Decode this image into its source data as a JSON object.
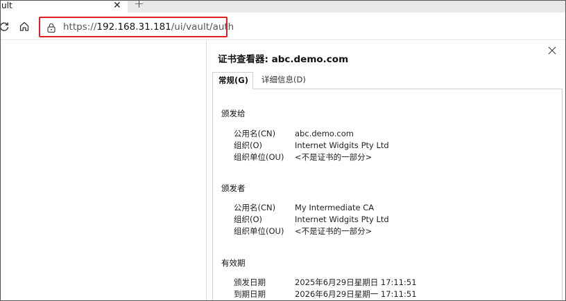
{
  "browser": {
    "tab_title": "ult",
    "tab_close": "✕",
    "new_tab": "+",
    "address": {
      "scheme": "https://",
      "host": "192.168.31.181",
      "path": "/ui/vault/auth"
    }
  },
  "cert_viewer": {
    "title": "证书查看器: abc.demo.com",
    "tabs": [
      {
        "label": "常规(G)",
        "active": true
      },
      {
        "label": "详细信息(D)",
        "active": false
      }
    ],
    "sections": [
      {
        "title": "颁发给",
        "rows": [
          {
            "k": "公用名(CN)",
            "v": "abc.demo.com"
          },
          {
            "k": "组织(O)",
            "v": "Internet Widgits Pty Ltd"
          },
          {
            "k": "组织单位(OU)",
            "v": "<不是证书的一部分>"
          }
        ]
      },
      {
        "title": "颁发者",
        "rows": [
          {
            "k": "公用名(CN)",
            "v": "My Intermediate CA"
          },
          {
            "k": "组织(O)",
            "v": "Internet Widgits Pty Ltd"
          },
          {
            "k": "组织单位(OU)",
            "v": "<不是证书的一部分>"
          }
        ]
      },
      {
        "title": "有效期",
        "rows": [
          {
            "k": "颁发日期",
            "v": "2025年6月29日星期日 17:11:51"
          },
          {
            "k": "到期日期",
            "v": "2026年6月29日星期一 17:11:51"
          }
        ]
      }
    ]
  }
}
